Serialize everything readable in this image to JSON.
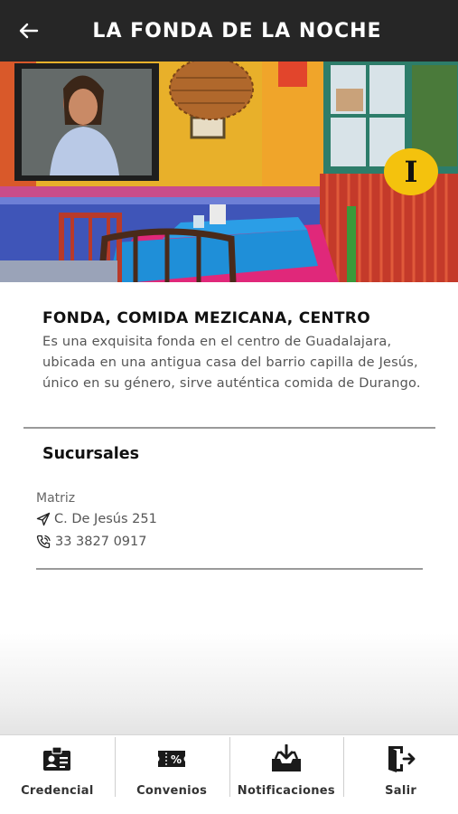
{
  "header": {
    "title": "LA FONDA DE LA NOCHE",
    "back_icon": "arrow-left-icon"
  },
  "hero": {
    "badge_text": "I",
    "badge_color": "#f4c20d"
  },
  "details": {
    "category": "FONDA, COMIDA MEZICANA, CENTRO",
    "description": "Es una exquisita fonda en el centro de Guadalajara, ubicada en una antigua casa del barrio capilla de Jesús, único en su género, sirve auténtica comida de Durango."
  },
  "branches": {
    "title": "Sucursales",
    "items": [
      {
        "name": "Matriz",
        "address": "C. De Jesús 251",
        "address_icon": "send-icon",
        "phone": "33 3827 0917",
        "phone_icon": "phone-icon"
      }
    ]
  },
  "tabbar": {
    "items": [
      {
        "label": "Credencial",
        "icon": "id-card-icon"
      },
      {
        "label": "Convenios",
        "icon": "discount-ticket-icon"
      },
      {
        "label": "Notificaciones",
        "icon": "inbox-download-icon"
      },
      {
        "label": "Salir",
        "icon": "exit-door-icon"
      }
    ]
  },
  "colors": {
    "header_bg": "#262626",
    "badge": "#f4c20d",
    "text_dark": "#111111",
    "text_muted": "#555555"
  }
}
